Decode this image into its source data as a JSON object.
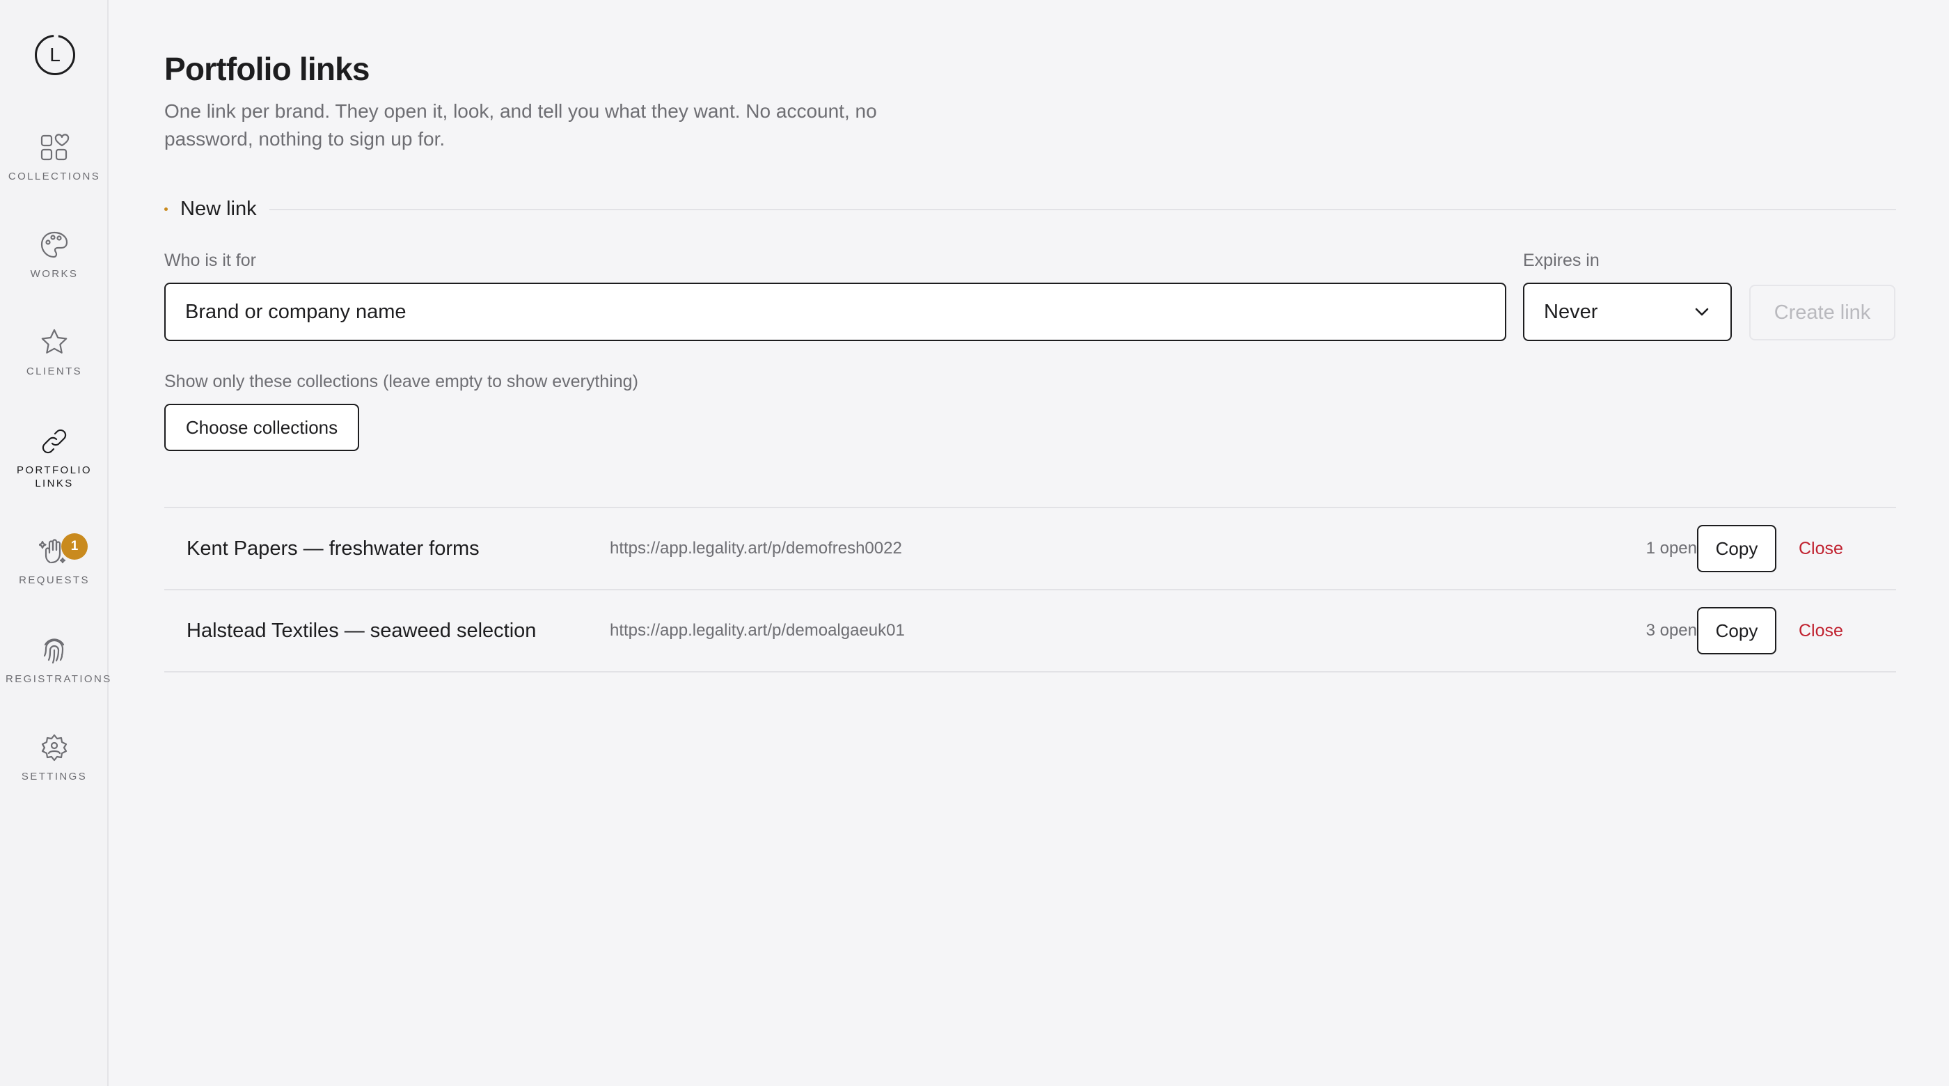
{
  "sidebar": {
    "logo_letter": "L",
    "items": [
      {
        "label": "COLLECTIONS",
        "icon": "collections-icon"
      },
      {
        "label": "WORKS",
        "icon": "palette-icon"
      },
      {
        "label": "CLIENTS",
        "icon": "star-icon"
      },
      {
        "label": "PORTFOLIO LINKS",
        "icon": "link-icon",
        "active": true
      },
      {
        "label": "REQUESTS",
        "icon": "hand-sparkle-icon",
        "badge": "1"
      },
      {
        "label": "REGISTRATIONS",
        "icon": "fingerprint-icon"
      },
      {
        "label": "SETTINGS",
        "icon": "gear-icon"
      }
    ]
  },
  "page": {
    "title": "Portfolio links",
    "subtitle": "One link per brand. They open it, look, and tell you what they want. No account, no password, nothing to sign up for."
  },
  "new_link": {
    "section_title": "New link",
    "who_label": "Who is it for",
    "who_placeholder": "Brand or company name",
    "expires_label": "Expires in",
    "expires_value": "Never",
    "create_label": "Create link",
    "collections_label": "Show only these collections (leave empty to show everything)",
    "choose_label": "Choose collections"
  },
  "links": [
    {
      "name": "Kent Papers — freshwater forms",
      "url": "https://app.legality.art/p/demofresh0022",
      "opens": "1 opens",
      "copy": "Copy",
      "close": "Close"
    },
    {
      "name": "Halstead Textiles — seaweed selection",
      "url": "https://app.legality.art/p/demoalgaeuk01",
      "opens": "3 opens",
      "copy": "Copy",
      "close": "Close"
    }
  ],
  "colors": {
    "accent": "#c98a1e",
    "danger": "#c0212f",
    "background": "#f5f5f7"
  }
}
